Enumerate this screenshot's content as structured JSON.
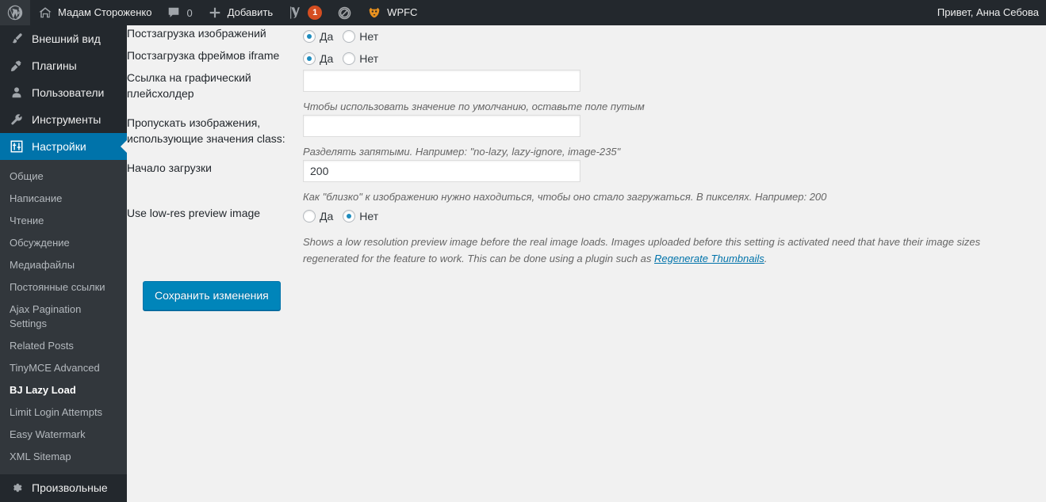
{
  "adminbar": {
    "wp_logo_icon": "wordpress-logo-icon",
    "site_home_icon": "home-icon",
    "site_name": "Мадам Стороженко",
    "comments_icon": "comment-bubble-icon",
    "comments_count": "0",
    "new_icon": "plus-icon",
    "new_label": "Добавить",
    "yoast_icon": "yoast-seo-icon",
    "yoast_badge": "1",
    "adblock_icon": "circle-slash-icon",
    "wpfc_icon": "wpfc-tiger-icon",
    "wpfc_label": "WPFC",
    "greeting": "Привет, Анна Себова"
  },
  "sidebar": {
    "top_items": [
      {
        "label": "Внешний вид",
        "icon": "appearance-brush-icon",
        "current": false
      },
      {
        "label": "Плагины",
        "icon": "plugins-plug-icon",
        "current": false
      },
      {
        "label": "Пользователи",
        "icon": "users-person-icon",
        "current": false
      },
      {
        "label": "Инструменты",
        "icon": "tools-wrench-icon",
        "current": false
      },
      {
        "label": "Настройки",
        "icon": "settings-sliders-icon",
        "current": true
      }
    ],
    "submenu_items": [
      {
        "label": "Общие",
        "current": false
      },
      {
        "label": "Написание",
        "current": false
      },
      {
        "label": "Чтение",
        "current": false
      },
      {
        "label": "Обсуждение",
        "current": false
      },
      {
        "label": "Медиафайлы",
        "current": false
      },
      {
        "label": "Постоянные ссылки",
        "current": false
      },
      {
        "label": "Ajax Pagination Settings",
        "current": false
      },
      {
        "label": "Related Posts",
        "current": false
      },
      {
        "label": "TinyMCE Advanced",
        "current": false
      },
      {
        "label": "BJ Lazy Load",
        "current": true
      },
      {
        "label": "Limit Login Attempts",
        "current": false
      },
      {
        "label": "Easy Watermark",
        "current": false
      },
      {
        "label": "XML Sitemap",
        "current": false
      }
    ],
    "bottom_item": {
      "label": "Произвольные",
      "icon": "gear-icon"
    }
  },
  "form": {
    "rows": [
      {
        "label": "Постзагрузка изображений",
        "type": "radio",
        "options": [
          {
            "label": "Да",
            "checked": true
          },
          {
            "label": "Нет",
            "checked": false
          }
        ],
        "desc": ""
      },
      {
        "label": "Постзагрузка фреймов iframe",
        "type": "radio",
        "options": [
          {
            "label": "Да",
            "checked": true
          },
          {
            "label": "Нет",
            "checked": false
          }
        ],
        "desc": ""
      },
      {
        "label": "Ссылка на графический плейсхолдер",
        "type": "text",
        "value": "",
        "placeholder": "",
        "desc": "Чтобы использовать значение по умолчанию, оставьте поле путым"
      },
      {
        "label": "Пропускать изображения, использующие значения class:",
        "type": "text",
        "value": "",
        "placeholder": "",
        "desc": "Разделять запятыми. Например: \"no-lazy, lazy-ignore, image-235\""
      },
      {
        "label": "Начало загрузки",
        "type": "text",
        "value": "200",
        "placeholder": "",
        "desc": "Как \"близко\" к изображению нужно находиться, чтобы оно стало загружаться. В пикселях. Например: 200"
      },
      {
        "label": "Use low-res preview image",
        "type": "radio",
        "options": [
          {
            "label": "Да",
            "checked": false
          },
          {
            "label": "Нет",
            "checked": true
          }
        ],
        "desc_parts": {
          "before": "Shows a low resolution preview image before the real image loads. Images uploaded before this setting is activated need that have their image sizes regenerated for the feature to work. This can be done using a plugin such as ",
          "link": "Regenerate Thumbnails",
          "after": "."
        }
      }
    ],
    "submit_label": "Сохранить изменения"
  },
  "colors": {
    "admin_blue": "#0073aa",
    "button_blue": "#0085ba",
    "sidebar_dark": "#23282d",
    "submenu_dark": "#32373c",
    "badge_orange": "#d54e21",
    "page_bg": "#f1f1f1"
  }
}
